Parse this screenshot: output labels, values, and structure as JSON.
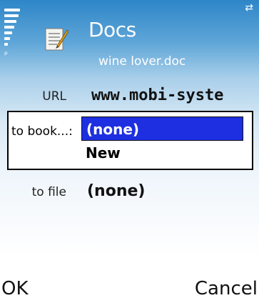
{
  "header": {
    "title": "Docs",
    "subtitle": "wine lover.doc",
    "icon": "document-edit-icon",
    "signal_icon": "signal-strength-icon"
  },
  "form": {
    "url_label": "URL",
    "url_value": "www.mobi-syste",
    "bookmark_label": "to book...:",
    "bookmark_options": [
      "(none)",
      "New"
    ],
    "file_label": "to file",
    "file_value": "(none)"
  },
  "softkeys": {
    "left": "OK",
    "right": "Cancel"
  },
  "colors": {
    "header_blue": "#2e86c8",
    "selection": "#1d2fe0"
  }
}
